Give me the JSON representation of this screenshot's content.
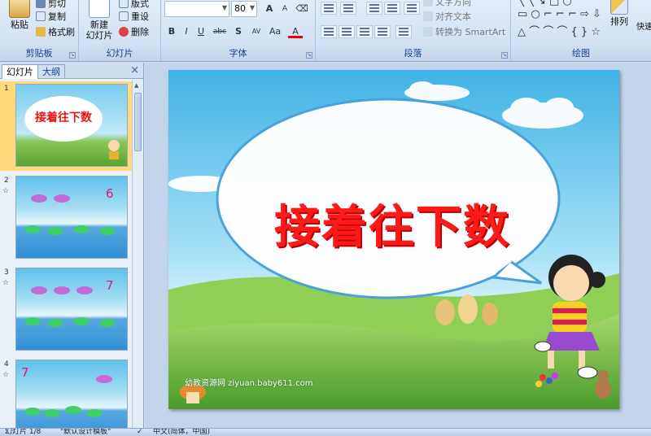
{
  "ribbon": {
    "clipboard": {
      "paste": "粘贴",
      "cut": "剪切",
      "copy": "复制",
      "format_painter": "格式刷",
      "label": "剪贴板"
    },
    "slides": {
      "new_slide": "新建\n幻灯片",
      "layout": "版式",
      "reset": "重设",
      "delete": "删除",
      "label": "幻灯片"
    },
    "font": {
      "font_name": "",
      "font_size": "80",
      "label": "字体",
      "bold": "B",
      "italic": "I",
      "underline": "U",
      "strike": "abc",
      "shadow": "S",
      "spacing": "AV",
      "case": "Aa",
      "color": "A",
      "grow": "A",
      "shrink": "A"
    },
    "paragraph": {
      "text_direction": "文字方向",
      "align_text": "对齐文本",
      "convert_smartart": "转换为 SmartArt",
      "label": "段落"
    },
    "drawing": {
      "arrange": "排列",
      "quick_styles": "快速",
      "label": "绘图"
    }
  },
  "left_pane": {
    "tabs": [
      "幻灯片",
      "大纲"
    ],
    "close": "×",
    "thumbnails": [
      {
        "number": "1",
        "title": "接着往下数"
      },
      {
        "number": "2",
        "value": "6"
      },
      {
        "number": "3",
        "value": "7"
      },
      {
        "number": "4",
        "value": "7"
      }
    ]
  },
  "slide": {
    "title": "接着往下数",
    "watermark": "幼教资源网 ziyuan.baby611.com"
  },
  "status": {
    "slide_info": "幻灯片 1/8",
    "theme": "\"默认设计模板\"",
    "language": "中文(简体，中国)"
  },
  "colors": {
    "title_red": "#ff1a1a",
    "selected_thumb": "#ffd97a",
    "ribbon_label": "#15428b"
  }
}
